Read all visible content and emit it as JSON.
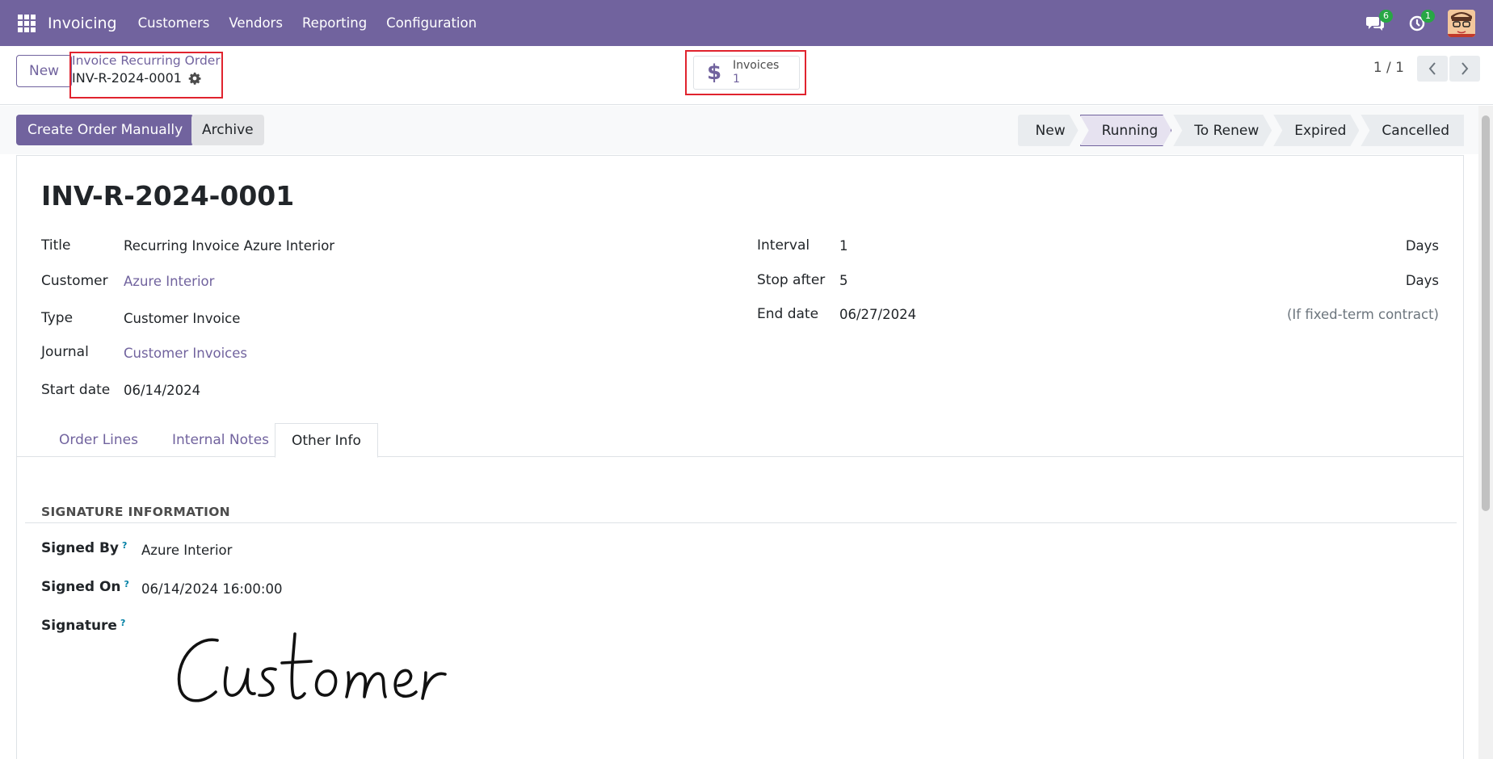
{
  "navbar": {
    "app_name": "Invoicing",
    "menu": [
      "Customers",
      "Vendors",
      "Reporting",
      "Configuration"
    ],
    "messages_count": "6",
    "activities_count": "1",
    "accent": "#71639e"
  },
  "control": {
    "new_label": "New",
    "breadcrumb_parent": "Invoice Recurring Order",
    "breadcrumb_current": "INV-R-2024-0001",
    "stat_label": "Invoices",
    "stat_value": "1",
    "pager": "1 / 1"
  },
  "actions": {
    "create_label": "Create Order Manually",
    "archive_label": "Archive",
    "stages": [
      "New",
      "Running",
      "To Renew",
      "Expired",
      "Cancelled"
    ],
    "active_stage": "Running"
  },
  "record": {
    "name": "INV-R-2024-0001",
    "left_fields": {
      "title_label": "Title",
      "title_value": "Recurring Invoice Azure Interior",
      "customer_label": "Customer",
      "customer_value": "Azure Interior",
      "type_label": "Type",
      "type_value": "Customer Invoice",
      "journal_label": "Journal",
      "journal_value": "Customer Invoices",
      "start_label": "Start date",
      "start_value": "06/14/2024"
    },
    "right_fields": {
      "interval_label": "Interval",
      "interval_value": "1",
      "interval_unit": "Days",
      "stop_label": "Stop after",
      "stop_value": "5",
      "stop_unit": "Days",
      "end_label": "End date",
      "end_value": "06/27/2024",
      "end_hint": "(If fixed-term contract)"
    }
  },
  "tabs": [
    "Order Lines",
    "Internal Notes",
    "Other Info"
  ],
  "active_tab": "Other Info",
  "other_info": {
    "section_title": "SIGNATURE INFORMATION",
    "signed_by_label": "Signed By",
    "signed_by_value": "Azure Interior",
    "signed_on_label": "Signed On",
    "signed_on_value": "06/14/2024 16:00:00",
    "signature_label": "Signature",
    "tooltip_mark": "?",
    "signature_text": "Customer"
  }
}
